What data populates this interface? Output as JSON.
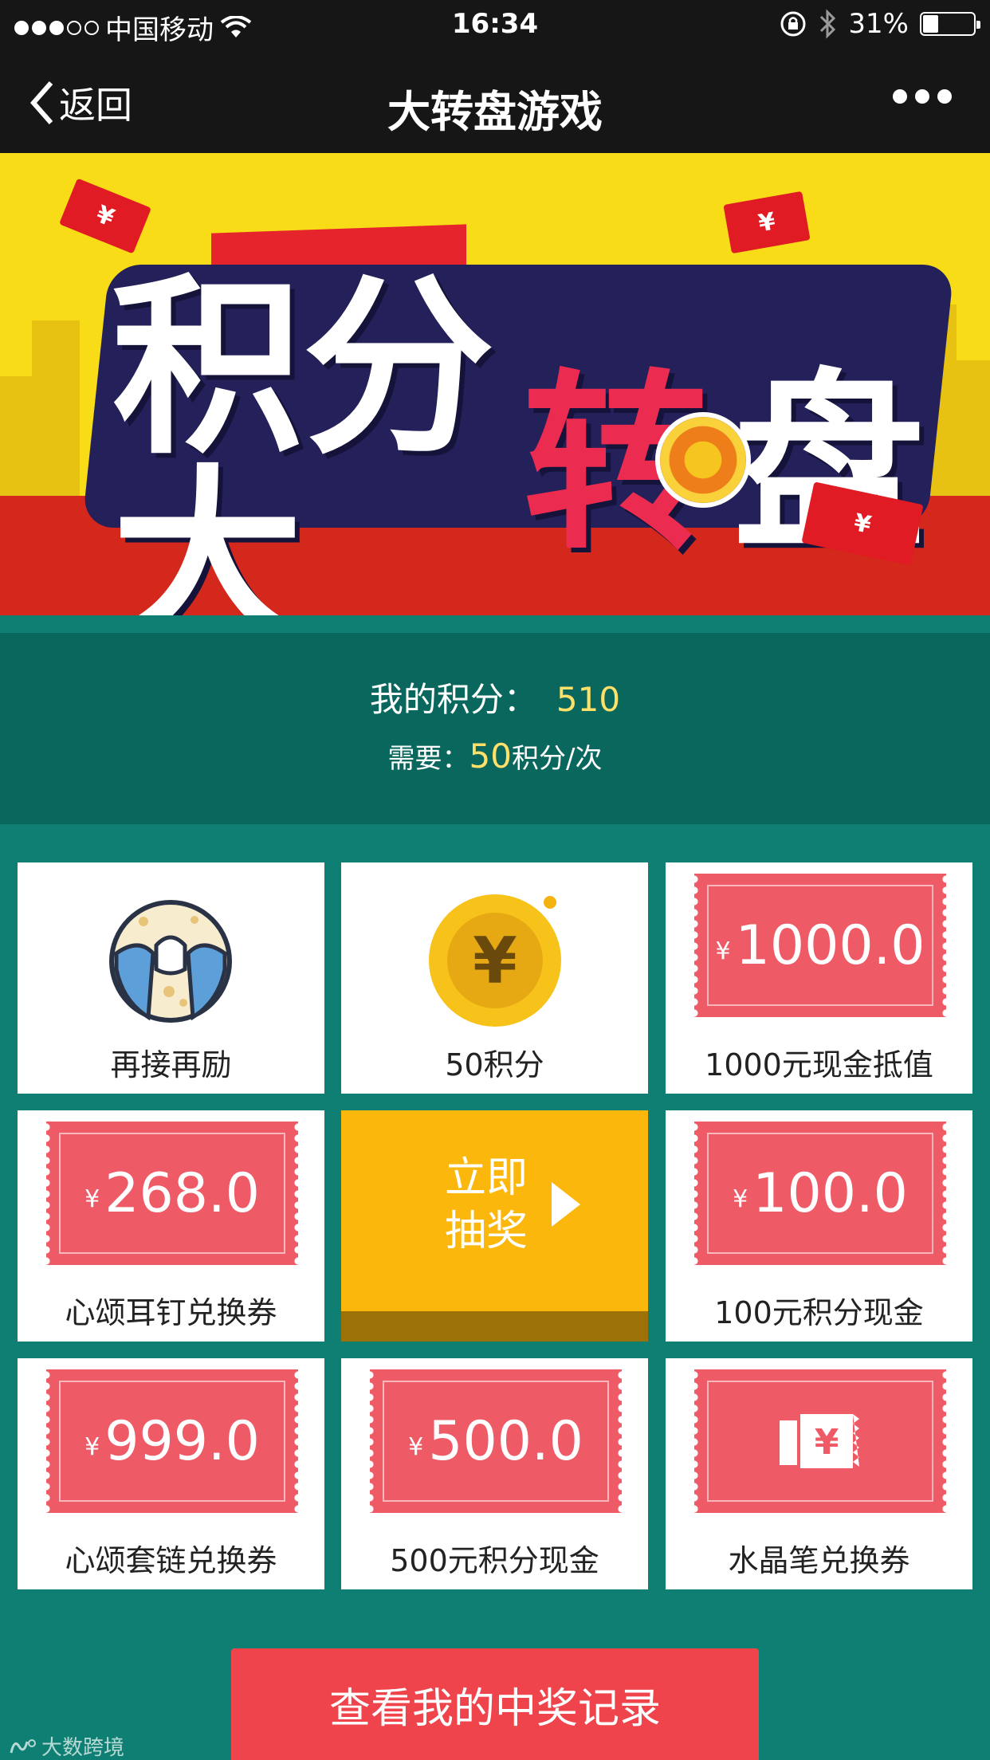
{
  "status_bar": {
    "carrier": "中国移动",
    "time": "16:34",
    "battery": "31%",
    "battery_level": 0.31,
    "signal_bars_filled": 3,
    "signal_bars_total": 5
  },
  "nav": {
    "back_label": "返回",
    "title": "大转盘游戏"
  },
  "banner": {
    "title_parts": [
      "积分大",
      "转",
      "盘"
    ],
    "envelope_symbol": "¥"
  },
  "score": {
    "my_points_label": "我的积分：",
    "my_points_value": "510",
    "need_label": "需要：",
    "need_value": "50",
    "need_unit": "积分/次"
  },
  "prizes": [
    {
      "label": "再接再励",
      "type": "icon",
      "icon": "crying-face-icon"
    },
    {
      "label": "50积分",
      "type": "icon",
      "icon": "yen-coin-icon"
    },
    {
      "label": "1000元现金抵值",
      "type": "ticket",
      "currency": "¥",
      "amount": "1000.0"
    },
    {
      "label": "心颂耳钉兑换券",
      "type": "ticket",
      "currency": "¥",
      "amount": "268.0"
    },
    {
      "label": "100元积分现金",
      "type": "ticket",
      "currency": "¥",
      "amount": "100.0"
    },
    {
      "label": "心颂套链兑换券",
      "type": "ticket",
      "currency": "¥",
      "amount": "999.0"
    },
    {
      "label": "500元积分现金",
      "type": "ticket",
      "currency": "¥",
      "amount": "500.0"
    },
    {
      "label": "水晶笔兑换券",
      "type": "ticket-icon",
      "icon": "voucher-ticket-icon",
      "symbol": "¥"
    }
  ],
  "draw_button": {
    "label": "立即抽奖"
  },
  "records_button": {
    "label": "查看我的中奖记录"
  },
  "watermark": "大数跨境",
  "colors": {
    "page_bg": "#0e7f72",
    "score_bg": "#0a675d",
    "highlight": "#ffe169",
    "ticket": "#ee5b66",
    "draw": "#fbb70c",
    "records_button": "#f0444c"
  }
}
